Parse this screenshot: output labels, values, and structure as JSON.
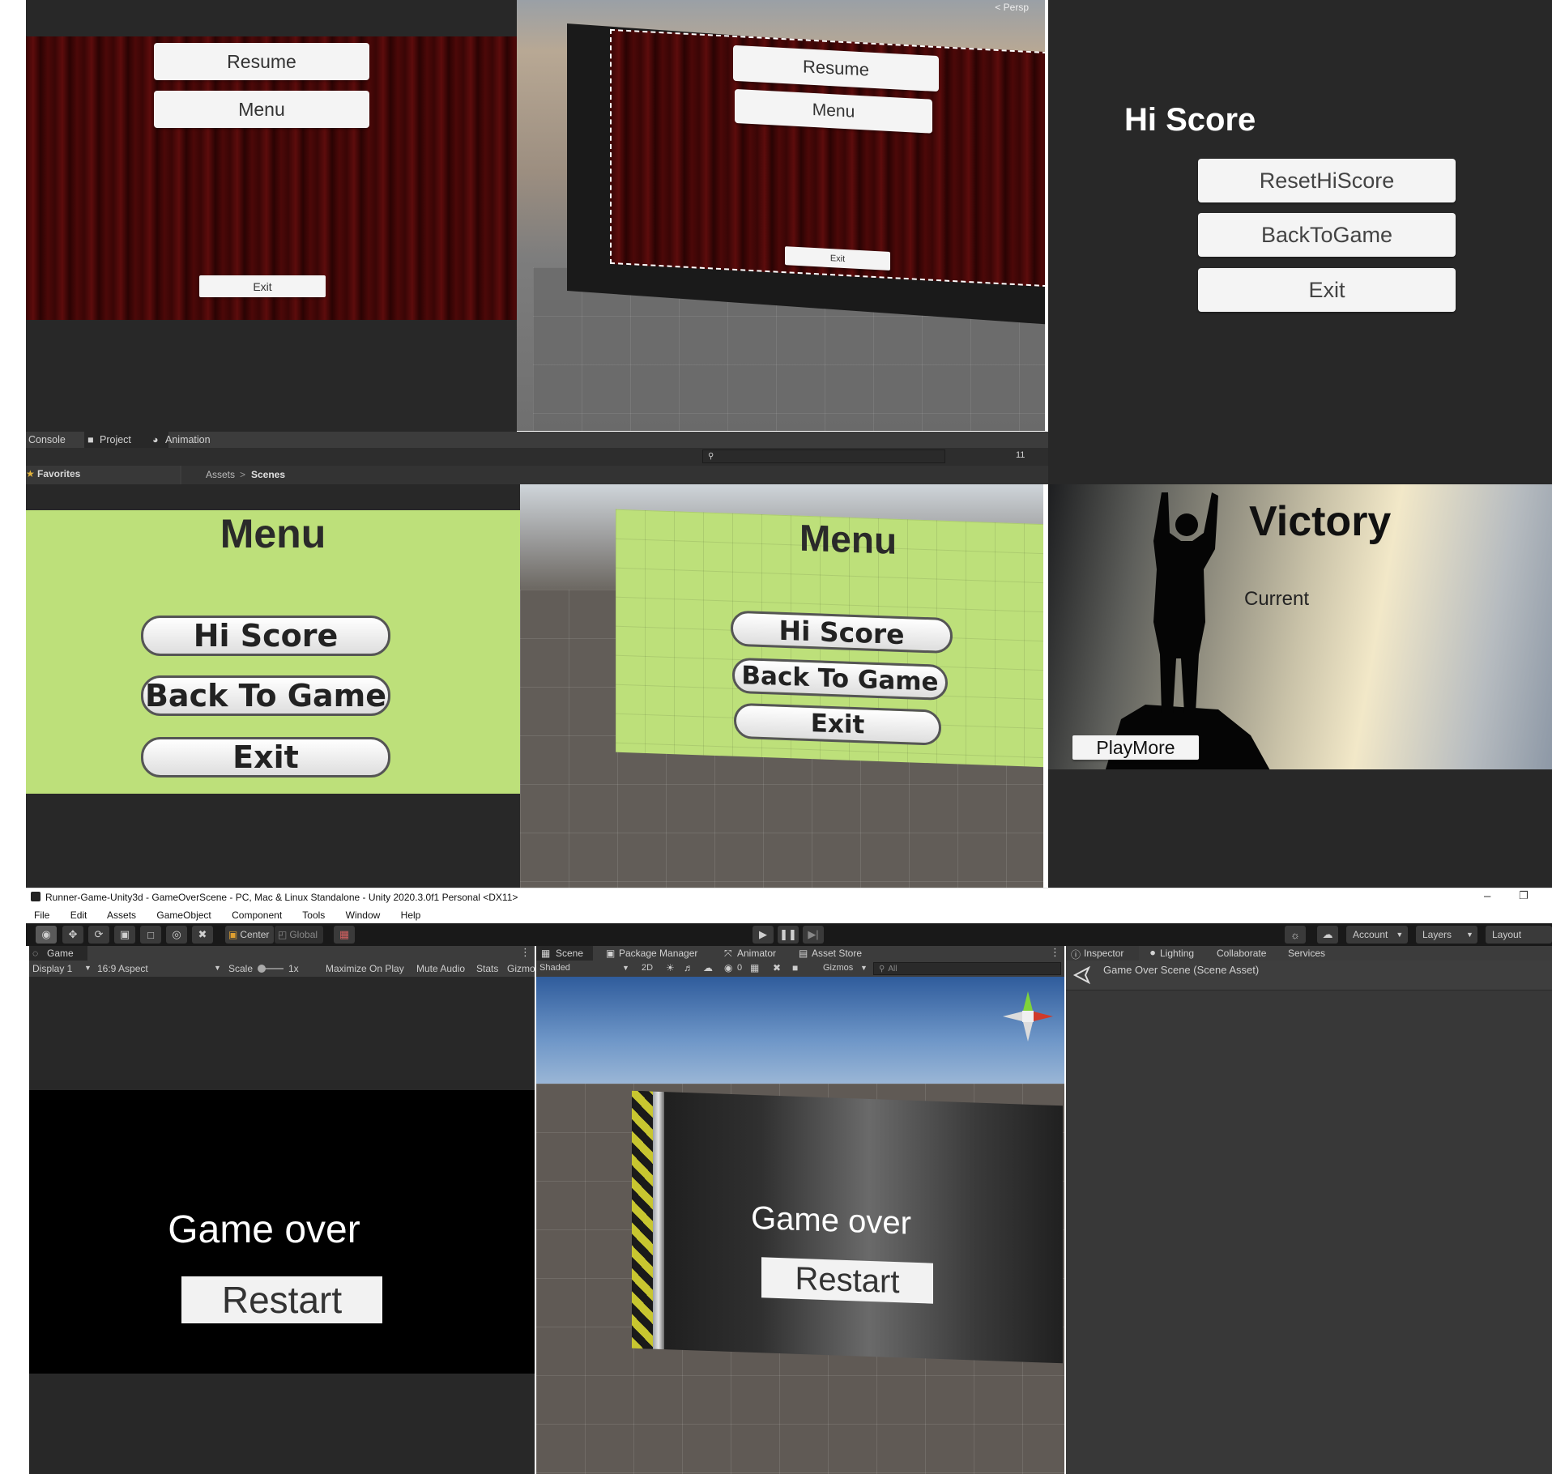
{
  "pause_panel_game": {
    "resume_label": "Resume",
    "menu_label": "Menu",
    "exit_label": "Exit"
  },
  "pause_panel_scene": {
    "persp_label": "< Persp",
    "resume_label": "Resume",
    "menu_label": "Menu",
    "exit_label": "Exit"
  },
  "hiscore_panel": {
    "title": "Hi Score",
    "reset_label": "ResetHiScore",
    "back_label": "BackToGame",
    "exit_label": "Exit"
  },
  "project_window": {
    "tabs": [
      "Console",
      "Project",
      "Animation"
    ],
    "favorites_label": "Favorites",
    "breadcrumb_root": "Assets",
    "breadcrumb_leaf": "Scenes",
    "hidden_count": "11"
  },
  "menu_panel_game": {
    "title": "Menu",
    "hiscore_label": "Hi Score",
    "back_label": "Back To Game",
    "exit_label": "Exit"
  },
  "menu_panel_scene": {
    "title": "Menu",
    "hiscore_label": "Hi Score",
    "back_label": "Back To Game",
    "exit_label": "Exit"
  },
  "victory_panel": {
    "title": "Victory",
    "current_label": "Current",
    "playmore_label": "PlayMore"
  },
  "editor": {
    "window_title": "Runner-Game-Unity3d - GameOverScene - PC, Mac & Linux Standalone - Unity 2020.3.0f1 Personal <DX11>",
    "menu_items": [
      "File",
      "Edit",
      "Assets",
      "GameObject",
      "Component",
      "Tools",
      "Window",
      "Help"
    ],
    "pivot_center": "Center",
    "pivot_global": "Global",
    "account_label": "Account",
    "layers_label": "Layers",
    "layout_label": "Layout",
    "game_tab": "Game",
    "display_label": "Display 1",
    "aspect_label": "16:9 Aspect",
    "scale_label": "Scale",
    "scale_value": "1x",
    "game_toolbar": [
      "Maximize On Play",
      "Mute Audio",
      "Stats",
      "Gizmo"
    ],
    "scene_tabs": [
      "Scene",
      "Package Manager",
      "Animator",
      "Asset Store"
    ],
    "shaded_label": "Shaded",
    "mode_2d": "2D",
    "hidden_count": "0",
    "gizmos_label": "Gizmos",
    "search_placeholder": "All",
    "inspector_tabs": [
      "Inspector",
      "Lighting",
      "Collaborate",
      "Services"
    ],
    "inspector_asset": "Game Over Scene (Scene Asset)",
    "gameover_text": "Game over",
    "restart_label": "Restart",
    "scene_gameover_text": "Game over",
    "scene_restart_label": "Restart"
  },
  "colors": {
    "unity_dark": "#282828",
    "menu_green": "#bde07a",
    "curtain_red": "#4a0808"
  }
}
